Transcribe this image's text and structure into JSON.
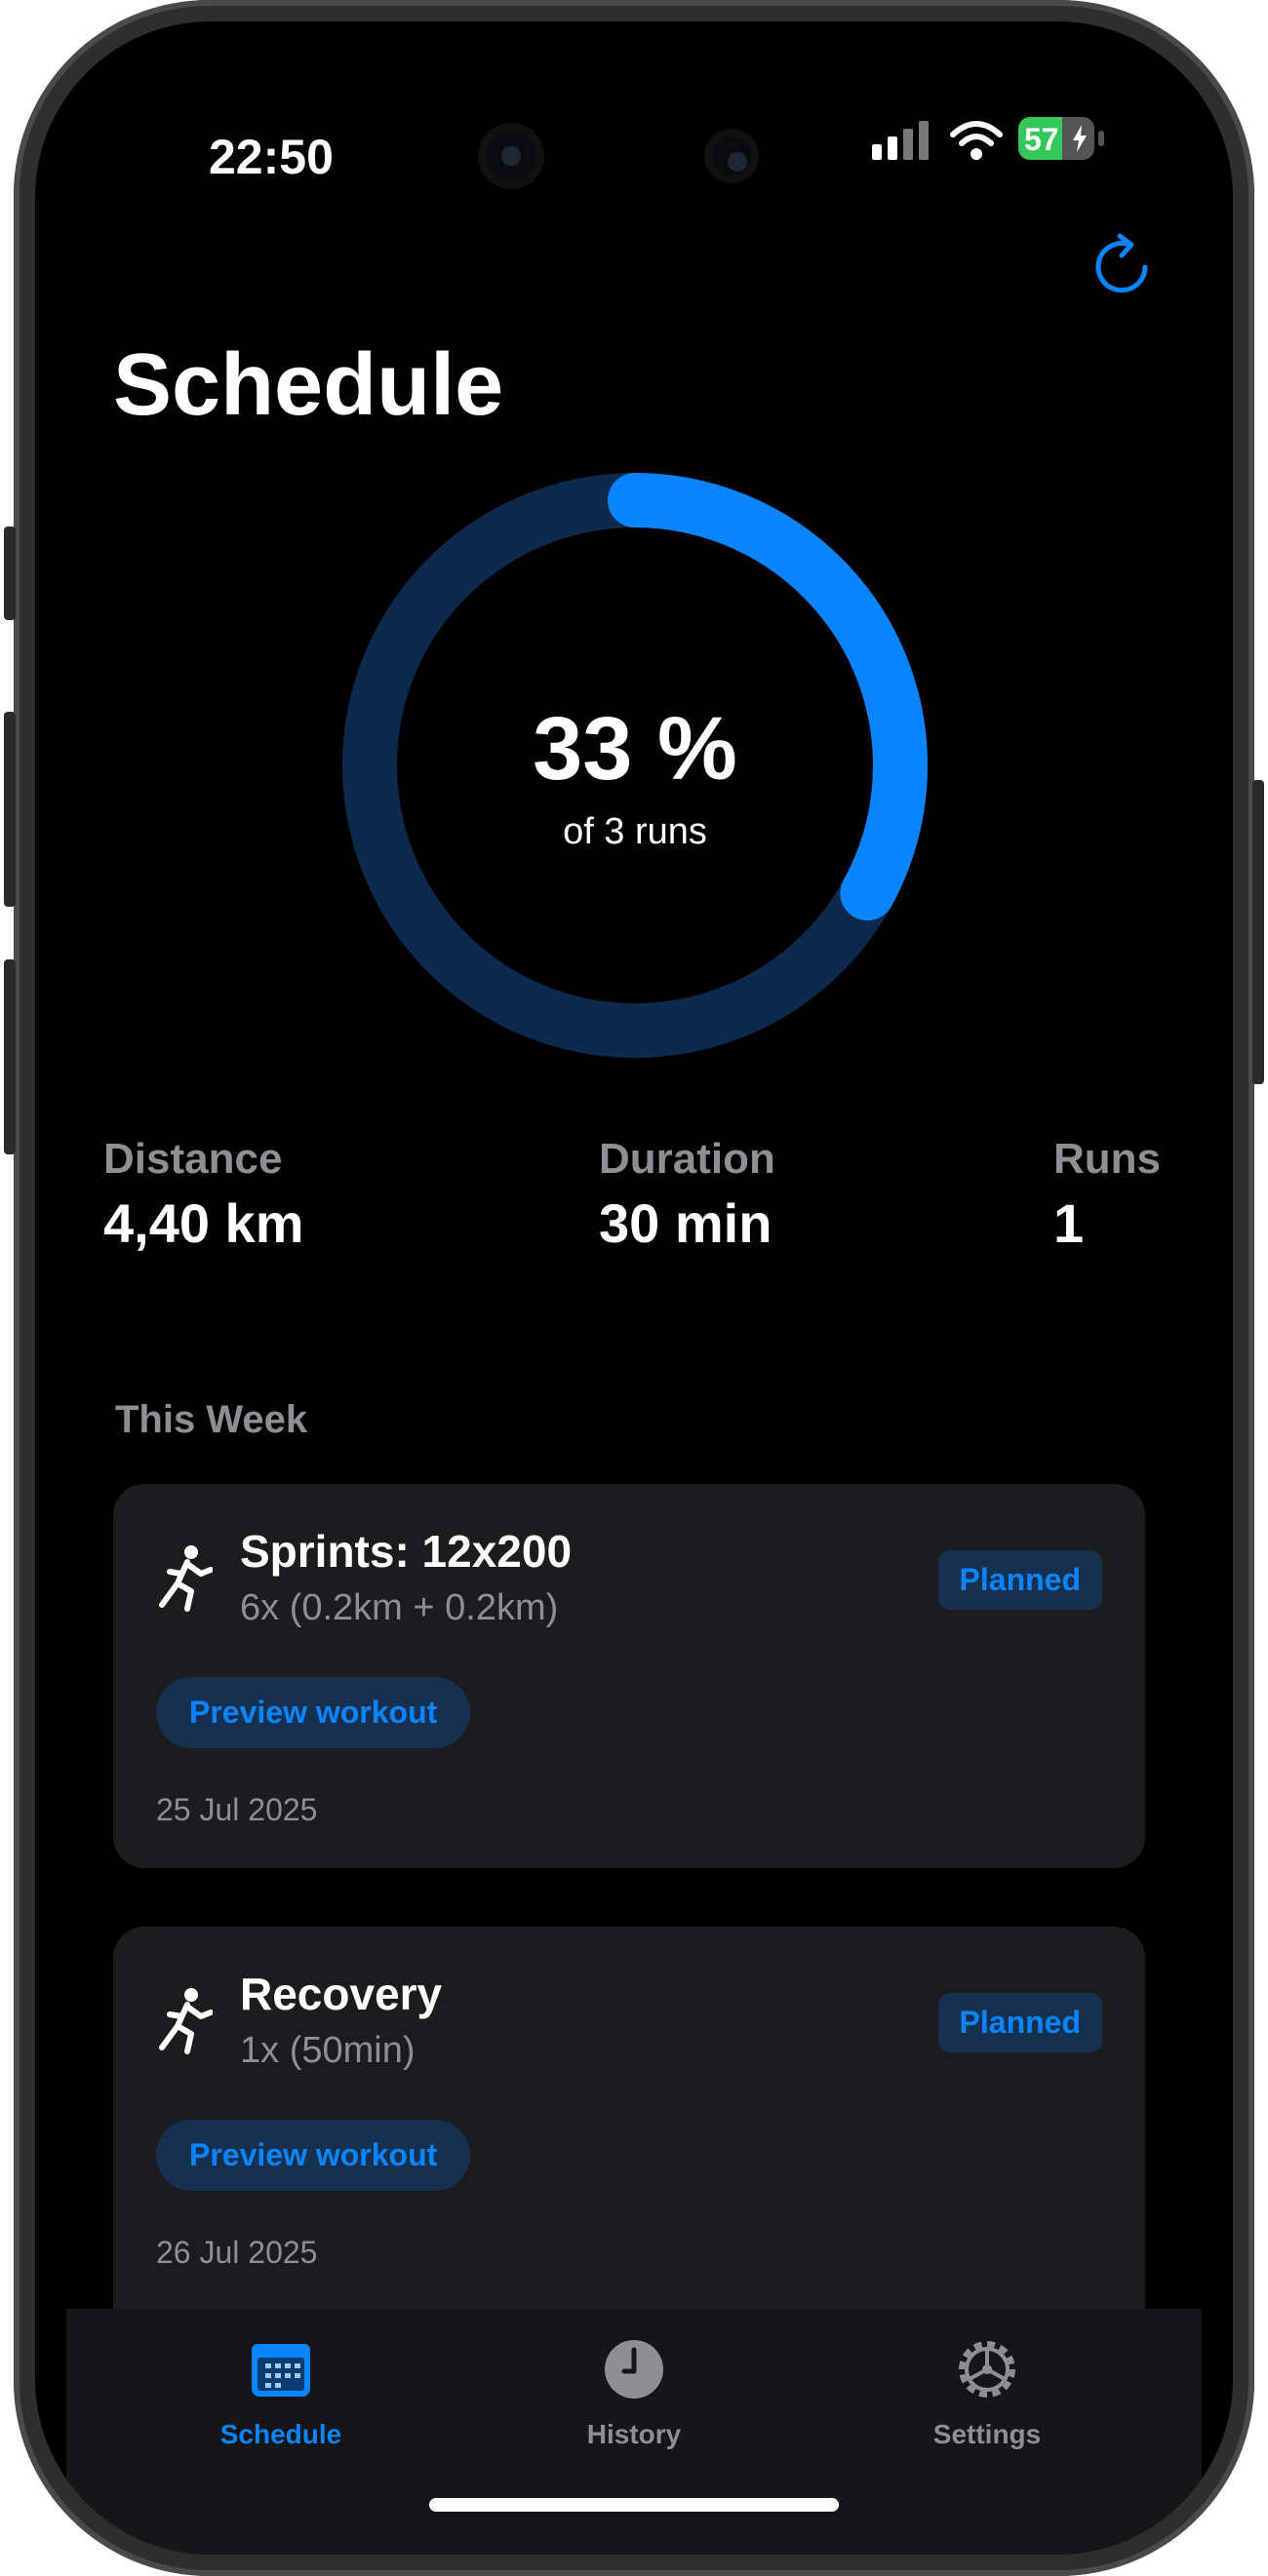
{
  "status_bar": {
    "time": "22:50",
    "battery": "57"
  },
  "page": {
    "title": "Schedule"
  },
  "progress": {
    "percent_label": "33 %",
    "subtitle": "of 3 runs",
    "fraction": 0.33
  },
  "stats": [
    {
      "label": "Distance",
      "value": "4,40 km"
    },
    {
      "label": "Duration",
      "value": "30 min"
    },
    {
      "label": "Runs",
      "value": "1"
    }
  ],
  "section": {
    "title": "This Week"
  },
  "workouts": [
    {
      "title": "Sprints: 12x200",
      "subtitle": "6x (0.2km + 0.2km)",
      "status": "Planned",
      "action": "Preview workout",
      "date": "25 Jul 2025"
    },
    {
      "title": "Recovery",
      "subtitle": "1x (50min)",
      "status": "Planned",
      "action": "Preview workout",
      "date": "26 Jul 2025"
    }
  ],
  "tabs": [
    {
      "label": "Schedule",
      "icon": "calendar-icon",
      "active": true
    },
    {
      "label": "History",
      "icon": "clock-icon",
      "active": false
    },
    {
      "label": "Settings",
      "icon": "gear-icon",
      "active": false
    }
  ],
  "colors": {
    "accent": "#0a84ff",
    "ring_track": "#0d2a4d",
    "card": "#1c1c1e",
    "muted": "#8e8e93"
  }
}
